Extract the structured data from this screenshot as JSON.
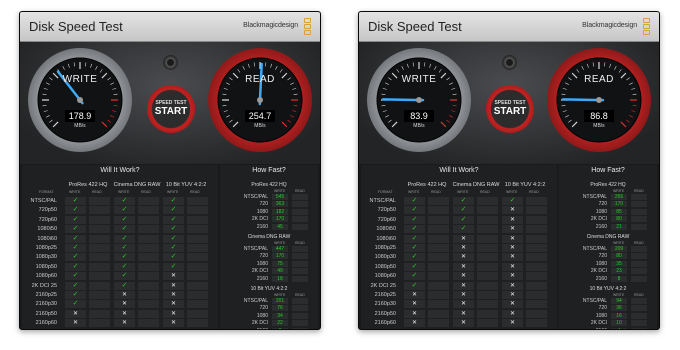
{
  "windows": [
    {
      "title": "Disk Speed Test",
      "brand": "Blackmagicdesign",
      "write": {
        "label": "WRITE",
        "value": "178.9",
        "unit": "MB/s",
        "level": 0.36
      },
      "read": {
        "label": "READ",
        "value": "254.7",
        "unit": "MB/s",
        "level": 0.51
      },
      "start": {
        "top": "SPEED TEST",
        "main": "START"
      },
      "will_it_work": {
        "title": "Will It Work?",
        "format_header": "FORMAT",
        "write_header": "WRITE",
        "read_header": "READ",
        "groups": [
          "ProRes 422 HQ",
          "Cinema DNG RAW",
          "10 Bit YUV 4:2:2"
        ],
        "rows": [
          {
            "format": "NTSC/PAL",
            "marks": [
              "✓",
              "✓",
              "✓"
            ]
          },
          {
            "format": "720p50",
            "marks": [
              "✓",
              "✓",
              "✓"
            ]
          },
          {
            "format": "720p60",
            "marks": [
              "✓",
              "✓",
              "✓"
            ]
          },
          {
            "format": "1080i50",
            "marks": [
              "✓",
              "✓",
              "✓"
            ]
          },
          {
            "format": "1080i60",
            "marks": [
              "✓",
              "✓",
              "✓"
            ]
          },
          {
            "format": "1080p25",
            "marks": [
              "✓",
              "✓",
              "✓"
            ]
          },
          {
            "format": "1080p30",
            "marks": [
              "✓",
              "✓",
              "✓"
            ]
          },
          {
            "format": "1080p50",
            "marks": [
              "✓",
              "✓",
              "✓"
            ]
          },
          {
            "format": "1080p60",
            "marks": [
              "✓",
              "✓",
              "✕"
            ]
          },
          {
            "format": "2K DCI 25",
            "marks": [
              "✓",
              "✓",
              "✕"
            ]
          },
          {
            "format": "2160p25",
            "marks": [
              "✓",
              "✕",
              "✕"
            ]
          },
          {
            "format": "2160p30",
            "marks": [
              "✓",
              "✕",
              "✕"
            ]
          },
          {
            "format": "2160p50",
            "marks": [
              "✕",
              "✕",
              "✕"
            ]
          },
          {
            "format": "2160p60",
            "marks": [
              "✕",
              "✕",
              "✕"
            ]
          }
        ]
      },
      "how_fast": {
        "title": "How Fast?",
        "write_header": "WRITE",
        "read_header": "READ",
        "groups": [
          {
            "name": "ProRes 422 HQ",
            "rows": [
              {
                "format": "NTSC/PAL",
                "value": "545"
              },
              {
                "format": "720",
                "value": "363"
              },
              {
                "format": "1080",
                "value": "182"
              },
              {
                "format": "2K DCI",
                "value": "170"
              },
              {
                "format": "2160",
                "value": "45"
              }
            ]
          },
          {
            "name": "Cinema DNG RAW",
            "rows": [
              {
                "format": "NTSC/PAL",
                "value": "447"
              },
              {
                "format": "720",
                "value": "170"
              },
              {
                "format": "1080",
                "value": "75"
              },
              {
                "format": "2K DCI",
                "value": "49"
              },
              {
                "format": "2160",
                "value": "18"
              }
            ]
          },
          {
            "name": "10 Bit YUV 4:2:2",
            "rows": [
              {
                "format": "NTSC/PAL",
                "value": "201"
              },
              {
                "format": "720",
                "value": "76"
              },
              {
                "format": "1080",
                "value": "34"
              },
              {
                "format": "2K DCI",
                "value": "22"
              },
              {
                "format": "2160",
                "value": "8"
              }
            ]
          }
        ]
      }
    },
    {
      "title": "Disk Speed Test",
      "brand": "Blackmagicdesign",
      "write": {
        "label": "WRITE",
        "value": "83.9",
        "unit": "MB/s",
        "level": 0.17
      },
      "read": {
        "label": "READ",
        "value": "86.8",
        "unit": "MB/s",
        "level": 0.17
      },
      "start": {
        "top": "SPEED TEST",
        "main": "START"
      },
      "will_it_work": {
        "title": "Will It Work?",
        "format_header": "FORMAT",
        "write_header": "WRITE",
        "read_header": "READ",
        "groups": [
          "ProRes 422 HQ",
          "Cinema DNG RAW",
          "10 Bit YUV 4:2:2"
        ],
        "rows": [
          {
            "format": "NTSC/PAL",
            "marks": [
              "✓",
              "✓",
              "✓"
            ]
          },
          {
            "format": "720p50",
            "marks": [
              "✓",
              "✓",
              "✕"
            ]
          },
          {
            "format": "720p60",
            "marks": [
              "✓",
              "✓",
              "✕"
            ]
          },
          {
            "format": "1080i50",
            "marks": [
              "✓",
              "✓",
              "✕"
            ]
          },
          {
            "format": "1080i60",
            "marks": [
              "✓",
              "✕",
              "✕"
            ]
          },
          {
            "format": "1080p25",
            "marks": [
              "✓",
              "✕",
              "✕"
            ]
          },
          {
            "format": "1080p30",
            "marks": [
              "✓",
              "✕",
              "✕"
            ]
          },
          {
            "format": "1080p50",
            "marks": [
              "✓",
              "✕",
              "✕"
            ]
          },
          {
            "format": "1080p60",
            "marks": [
              "✓",
              "✕",
              "✕"
            ]
          },
          {
            "format": "2K DCI 25",
            "marks": [
              "✓",
              "✕",
              "✕"
            ]
          },
          {
            "format": "2160p25",
            "marks": [
              "✕",
              "✕",
              "✕"
            ]
          },
          {
            "format": "2160p30",
            "marks": [
              "✕",
              "✕",
              "✕"
            ]
          },
          {
            "format": "2160p50",
            "marks": [
              "✕",
              "✕",
              "✕"
            ]
          },
          {
            "format": "2160p60",
            "marks": [
              "✕",
              "✕",
              "✕"
            ]
          }
        ]
      },
      "how_fast": {
        "title": "How Fast?",
        "write_header": "WRITE",
        "read_header": "READ",
        "groups": [
          {
            "name": "ProRes 422 HQ",
            "rows": [
              {
                "format": "NTSC/PAL",
                "value": "256"
              },
              {
                "format": "720",
                "value": "170"
              },
              {
                "format": "1080",
                "value": "85"
              },
              {
                "format": "2K DCI",
                "value": "80"
              },
              {
                "format": "2160",
                "value": "21"
              }
            ]
          },
          {
            "name": "Cinema DNG RAW",
            "rows": [
              {
                "format": "NTSC/PAL",
                "value": "209"
              },
              {
                "format": "720",
                "value": "80"
              },
              {
                "format": "1080",
                "value": "35"
              },
              {
                "format": "2K DCI",
                "value": "23"
              },
              {
                "format": "2160",
                "value": "8"
              }
            ]
          },
          {
            "name": "10 Bit YUV 4:2:2",
            "rows": [
              {
                "format": "NTSC/PAL",
                "value": "94"
              },
              {
                "format": "720",
                "value": "36"
              },
              {
                "format": "1080",
                "value": "16"
              },
              {
                "format": "2K DCI",
                "value": "10"
              },
              {
                "format": "2160",
                "value": "4"
              }
            ]
          }
        ]
      }
    }
  ]
}
